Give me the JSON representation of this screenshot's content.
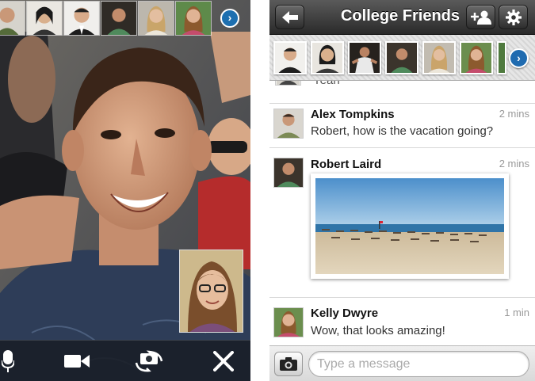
{
  "call": {
    "participants_strip": [
      "participant-1",
      "participant-2",
      "participant-3",
      "participant-4",
      "participant-5",
      "participant-6"
    ],
    "toolbar": {
      "mic_icon": "microphone-icon",
      "video_icon": "video-camera-icon",
      "flip_icon": "switch-camera-icon",
      "end_icon": "close-icon"
    }
  },
  "chat": {
    "title": "College Friends",
    "nav": {
      "back_icon": "back-arrow-icon",
      "add_icon": "add-person-icon",
      "settings_icon": "gear-icon"
    },
    "members_count_visible": 7,
    "partial_text": "Yeah",
    "messages": [
      {
        "name": "Alex Tompkins",
        "time": "2 mins",
        "text": "Robert, how is the vacation going?"
      },
      {
        "name": "Robert Laird",
        "time": "2 mins",
        "text": ""
      },
      {
        "name": "Kelly Dwyre",
        "time": "1 min",
        "text": "Wow, that looks amazing!"
      }
    ],
    "composer": {
      "placeholder": "Type a message",
      "camera_icon": "camera-icon"
    }
  },
  "colors": {
    "nav_dark": "#2a2a2a",
    "accent_blue": "#1f6bb0",
    "sea_blue": "#3f84b8",
    "sand": "#d8c9ad"
  }
}
